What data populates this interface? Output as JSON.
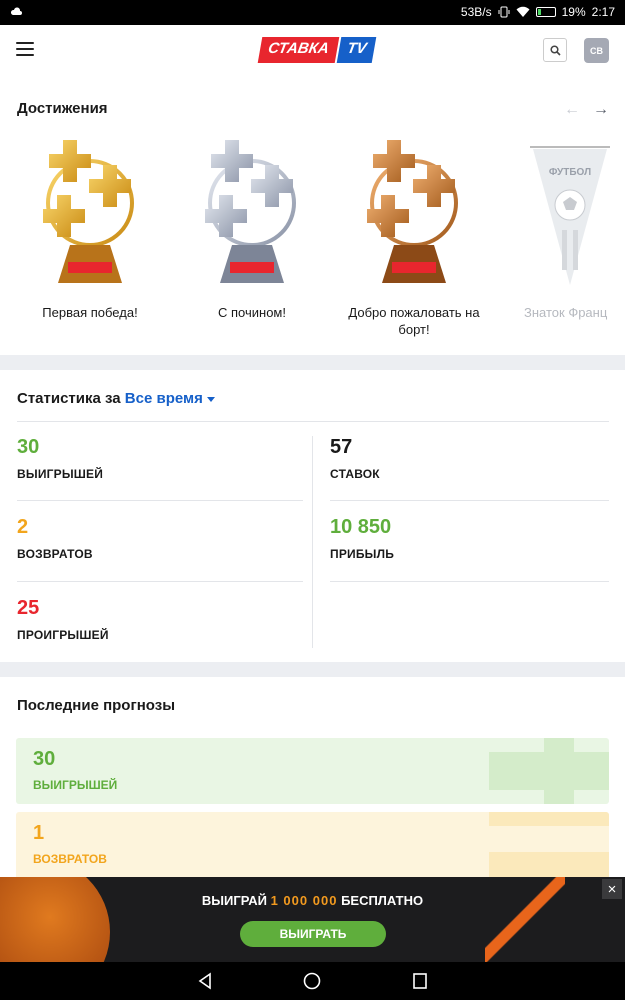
{
  "status_bar": {
    "speed": "53B/s",
    "battery": "19%",
    "time": "2:17"
  },
  "header": {
    "logo_part1": "СТАВКА",
    "logo_part2": "TV",
    "avatar": "СВ"
  },
  "achievements": {
    "title": "Достижения",
    "items": [
      {
        "label": "Первая победа!",
        "tier": "gold"
      },
      {
        "label": "С почином!",
        "tier": "silver"
      },
      {
        "label": "Добро пожаловать на борт!",
        "tier": "bronze"
      },
      {
        "label": "Знаток Франц",
        "tier": "pennant",
        "pennant_text": "ФУТБОЛ"
      }
    ],
    "trophy_badge": "СТАВКА TV"
  },
  "stats": {
    "title": "Статистика за",
    "period": "Все время",
    "wins": {
      "value": "30",
      "label": "ВЫИГРЫШЕЙ"
    },
    "returns": {
      "value": "2",
      "label": "ВОЗВРАТОВ"
    },
    "losses": {
      "value": "25",
      "label": "ПРОИГРЫШЕЙ"
    },
    "bets": {
      "value": "57",
      "label": "СТАВОК"
    },
    "profit": {
      "value": "10 850",
      "label": "ПРИБЫЛЬ"
    }
  },
  "recent": {
    "title": "Последние прогнозы",
    "cards": [
      {
        "value": "30",
        "label": "ВЫИГРЫШЕЙ"
      },
      {
        "value": "1",
        "label": "ВОЗВРАТОВ"
      }
    ]
  },
  "promo": {
    "text_before": "ВЫИГРАЙ",
    "highlight": "1 000 000",
    "text_after": "БЕСПЛАТНО",
    "button": "ВЫИГРАТЬ"
  },
  "colors": {
    "accent_blue": "#1660c9",
    "brand_red": "#e8262e",
    "win_green": "#5fae3c",
    "return_orange": "#f2a51d"
  }
}
